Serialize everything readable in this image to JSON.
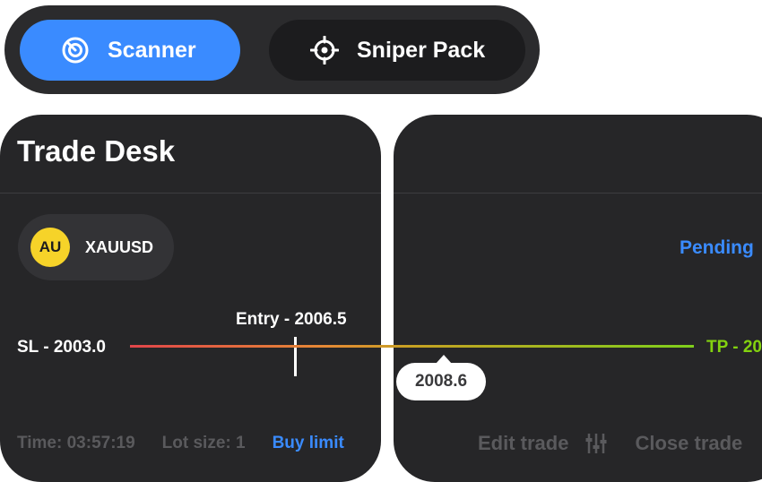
{
  "tabs": {
    "scanner_label": "Scanner",
    "sniper_label": "Sniper Pack"
  },
  "trade_desk": {
    "title": "Trade Desk",
    "pair_badge": "AU",
    "pair_name": "XAUUSD",
    "entry_label": "Entry - 2006.5",
    "sl_label": "SL - 2003.0",
    "time_label": "Time: 03:57:19",
    "lot_label": "Lot size: 1",
    "order_type": "Buy limit"
  },
  "trade_panel": {
    "status": "Pending",
    "tp_label": "TP - 20",
    "current_price": "2008.6",
    "edit_label": "Edit trade",
    "close_label": "Close trade"
  },
  "colors": {
    "accent": "#3a8bff",
    "tab_bg": "#2b2b2d",
    "card_bg": "#262628",
    "badge": "#f6d329",
    "sl": "#e2454a",
    "tp": "#83d20f"
  },
  "icons": {
    "scanner": "radar-icon",
    "sniper": "crosshair-icon",
    "edit": "sliders-icon"
  }
}
